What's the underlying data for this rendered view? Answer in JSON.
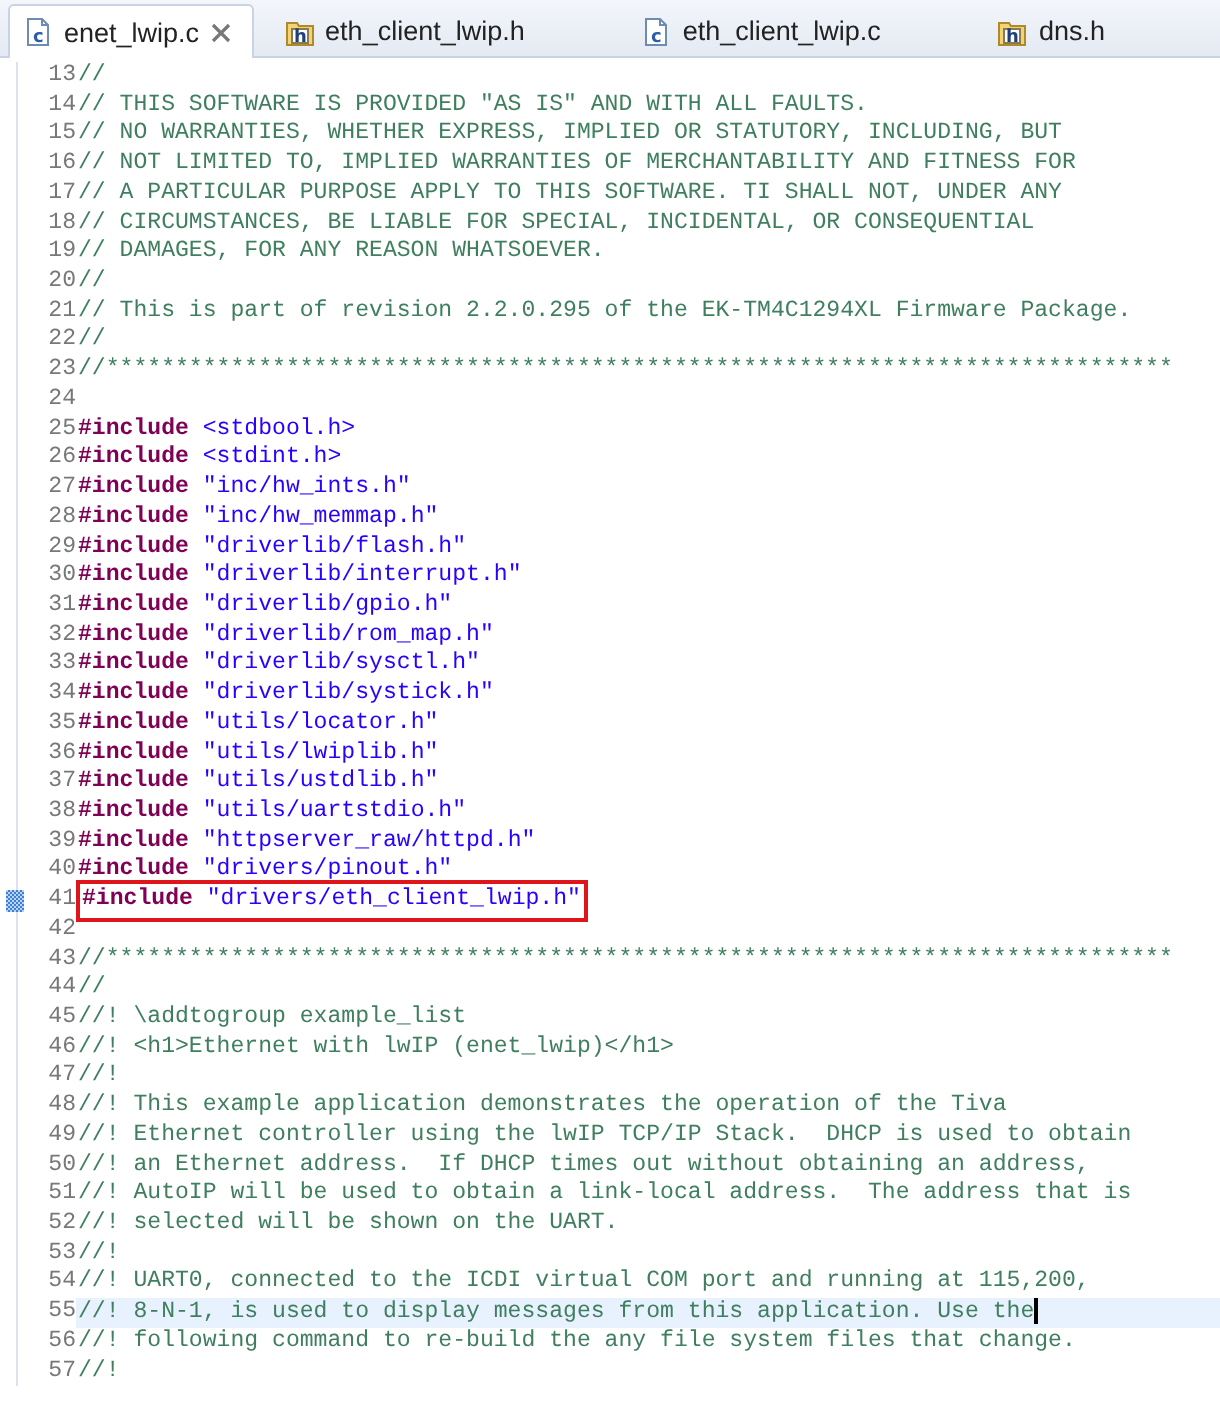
{
  "tabs": [
    {
      "label": "enet_lwip.c",
      "kind": "source",
      "icon_letter": "c",
      "selected": true
    },
    {
      "label": "eth_client_lwip.h",
      "kind": "header",
      "icon_letter": "h",
      "selected": false
    },
    {
      "label": "eth_client_lwip.c",
      "kind": "source",
      "icon_letter": "c",
      "selected": false
    },
    {
      "label": "dns.h",
      "kind": "header",
      "icon_letter": "h",
      "selected": false
    }
  ],
  "lines": [
    {
      "number": "13",
      "kind": "comment",
      "text": "//",
      "current": false,
      "boxed": false,
      "marker": false
    },
    {
      "number": "14",
      "kind": "comment",
      "text": "// THIS SOFTWARE IS PROVIDED \"AS IS\" AND WITH ALL FAULTS.",
      "current": false,
      "boxed": false,
      "marker": false
    },
    {
      "number": "15",
      "kind": "comment",
      "text": "// NO WARRANTIES, WHETHER EXPRESS, IMPLIED OR STATUTORY, INCLUDING, BUT",
      "current": false,
      "boxed": false,
      "marker": false
    },
    {
      "number": "16",
      "kind": "comment",
      "text": "// NOT LIMITED TO, IMPLIED WARRANTIES OF MERCHANTABILITY AND FITNESS FOR",
      "current": false,
      "boxed": false,
      "marker": false
    },
    {
      "number": "17",
      "kind": "comment",
      "text": "// A PARTICULAR PURPOSE APPLY TO THIS SOFTWARE. TI SHALL NOT, UNDER ANY",
      "current": false,
      "boxed": false,
      "marker": false
    },
    {
      "number": "18",
      "kind": "comment",
      "text": "// CIRCUMSTANCES, BE LIABLE FOR SPECIAL, INCIDENTAL, OR CONSEQUENTIAL",
      "current": false,
      "boxed": false,
      "marker": false
    },
    {
      "number": "19",
      "kind": "comment",
      "text": "// DAMAGES, FOR ANY REASON WHATSOEVER.",
      "current": false,
      "boxed": false,
      "marker": false
    },
    {
      "number": "20",
      "kind": "comment",
      "text": "//",
      "current": false,
      "boxed": false,
      "marker": false
    },
    {
      "number": "21",
      "kind": "comment",
      "text": "// This is part of revision 2.2.0.295 of the EK-TM4C1294XL Firmware Package.",
      "current": false,
      "boxed": false,
      "marker": false
    },
    {
      "number": "22",
      "kind": "comment",
      "text": "//",
      "current": false,
      "boxed": false,
      "marker": false
    },
    {
      "number": "23",
      "kind": "comment",
      "text": "//*****************************************************************************",
      "current": false,
      "boxed": false,
      "marker": false
    },
    {
      "number": "24",
      "kind": "blank",
      "current": false,
      "boxed": false,
      "marker": false
    },
    {
      "number": "25",
      "kind": "include",
      "directive": "#include",
      "target": "<stdbool.h>",
      "current": false,
      "boxed": false,
      "marker": false
    },
    {
      "number": "26",
      "kind": "include",
      "directive": "#include",
      "target": "<stdint.h>",
      "current": false,
      "boxed": false,
      "marker": false
    },
    {
      "number": "27",
      "kind": "include",
      "directive": "#include",
      "target": "\"inc/hw_ints.h\"",
      "current": false,
      "boxed": false,
      "marker": false
    },
    {
      "number": "28",
      "kind": "include",
      "directive": "#include",
      "target": "\"inc/hw_memmap.h\"",
      "current": false,
      "boxed": false,
      "marker": false
    },
    {
      "number": "29",
      "kind": "include",
      "directive": "#include",
      "target": "\"driverlib/flash.h\"",
      "current": false,
      "boxed": false,
      "marker": false
    },
    {
      "number": "30",
      "kind": "include",
      "directive": "#include",
      "target": "\"driverlib/interrupt.h\"",
      "current": false,
      "boxed": false,
      "marker": false
    },
    {
      "number": "31",
      "kind": "include",
      "directive": "#include",
      "target": "\"driverlib/gpio.h\"",
      "current": false,
      "boxed": false,
      "marker": false
    },
    {
      "number": "32",
      "kind": "include",
      "directive": "#include",
      "target": "\"driverlib/rom_map.h\"",
      "current": false,
      "boxed": false,
      "marker": false
    },
    {
      "number": "33",
      "kind": "include",
      "directive": "#include",
      "target": "\"driverlib/sysctl.h\"",
      "current": false,
      "boxed": false,
      "marker": false
    },
    {
      "number": "34",
      "kind": "include",
      "directive": "#include",
      "target": "\"driverlib/systick.h\"",
      "current": false,
      "boxed": false,
      "marker": false
    },
    {
      "number": "35",
      "kind": "include",
      "directive": "#include",
      "target": "\"utils/locator.h\"",
      "current": false,
      "boxed": false,
      "marker": false
    },
    {
      "number": "36",
      "kind": "include",
      "directive": "#include",
      "target": "\"utils/lwiplib.h\"",
      "current": false,
      "boxed": false,
      "marker": false
    },
    {
      "number": "37",
      "kind": "include",
      "directive": "#include",
      "target": "\"utils/ustdlib.h\"",
      "current": false,
      "boxed": false,
      "marker": false
    },
    {
      "number": "38",
      "kind": "include",
      "directive": "#include",
      "target": "\"utils/uartstdio.h\"",
      "current": false,
      "boxed": false,
      "marker": false
    },
    {
      "number": "39",
      "kind": "include",
      "directive": "#include",
      "target": "\"httpserver_raw/httpd.h\"",
      "current": false,
      "boxed": false,
      "marker": false
    },
    {
      "number": "40",
      "kind": "include",
      "directive": "#include",
      "target": "\"drivers/pinout.h\"",
      "current": false,
      "boxed": false,
      "marker": false
    },
    {
      "number": "41",
      "kind": "include",
      "directive": "#include",
      "target": "\"drivers/eth_client_lwip.h\"",
      "current": false,
      "boxed": true,
      "marker": true
    },
    {
      "number": "42",
      "kind": "blank",
      "current": false,
      "boxed": false,
      "marker": false
    },
    {
      "number": "43",
      "kind": "comment",
      "text": "//*****************************************************************************",
      "current": false,
      "boxed": false,
      "marker": false
    },
    {
      "number": "44",
      "kind": "comment",
      "text": "//",
      "current": false,
      "boxed": false,
      "marker": false
    },
    {
      "number": "45",
      "kind": "comment",
      "text": "//! \\addtogroup example_list",
      "current": false,
      "boxed": false,
      "marker": false
    },
    {
      "number": "46",
      "kind": "comment",
      "text": "//! <h1>Ethernet with lwIP (enet_lwip)</h1>",
      "current": false,
      "boxed": false,
      "marker": false
    },
    {
      "number": "47",
      "kind": "comment",
      "text": "//!",
      "current": false,
      "boxed": false,
      "marker": false
    },
    {
      "number": "48",
      "kind": "comment",
      "text": "//! This example application demonstrates the operation of the Tiva",
      "current": false,
      "boxed": false,
      "marker": false
    },
    {
      "number": "49",
      "kind": "comment",
      "text": "//! Ethernet controller using the lwIP TCP/IP Stack.  DHCP is used to obtain",
      "current": false,
      "boxed": false,
      "marker": false
    },
    {
      "number": "50",
      "kind": "comment",
      "text": "//! an Ethernet address.  If DHCP times out without obtaining an address,",
      "current": false,
      "boxed": false,
      "marker": false
    },
    {
      "number": "51",
      "kind": "comment",
      "text": "//! AutoIP will be used to obtain a link-local address.  The address that is",
      "current": false,
      "boxed": false,
      "marker": false
    },
    {
      "number": "52",
      "kind": "comment",
      "text": "//! selected will be shown on the UART.",
      "current": false,
      "boxed": false,
      "marker": false
    },
    {
      "number": "53",
      "kind": "comment",
      "text": "//!",
      "current": false,
      "boxed": false,
      "marker": false
    },
    {
      "number": "54",
      "kind": "comment",
      "text": "//! UART0, connected to the ICDI virtual COM port and running at 115,200,",
      "current": false,
      "boxed": false,
      "marker": false
    },
    {
      "number": "55",
      "kind": "comment",
      "text": "//! 8-N-1, is used to display messages from this application. Use the",
      "current": true,
      "boxed": false,
      "marker": false
    },
    {
      "number": "56",
      "kind": "comment",
      "text": "//! following command to re-build the any file system files that change.",
      "current": false,
      "boxed": false,
      "marker": false
    },
    {
      "number": "57",
      "kind": "comment",
      "text": "//!",
      "current": false,
      "boxed": false,
      "marker": false
    }
  ]
}
